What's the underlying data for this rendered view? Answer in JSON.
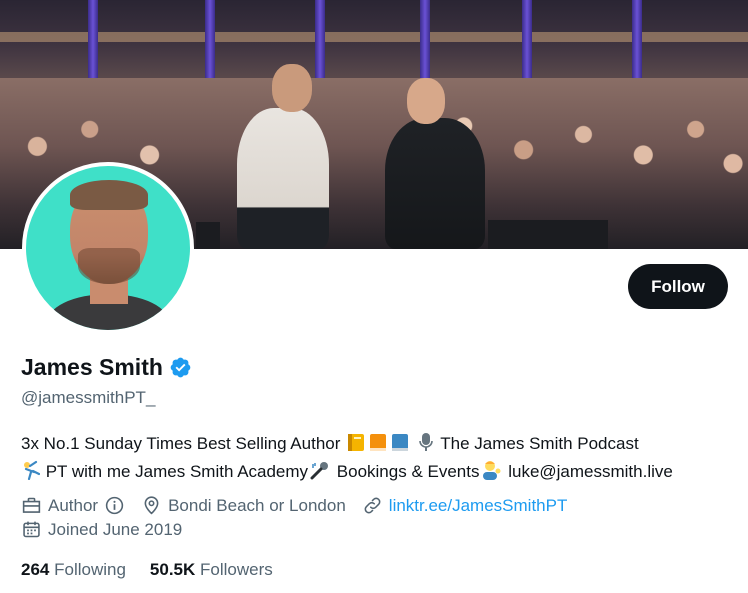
{
  "profile": {
    "display_name": "James Smith",
    "handle": "@jamessmithPT_",
    "verified": true,
    "follow_label": "Follow"
  },
  "bio": {
    "line1_text1": "3x No.1 Sunday Times Best Selling Author ",
    "line1_text2": " The James Smith Podcast",
    "line2_text1": " PT with me James Smith Academy",
    "line2_text2": " Bookings & Events",
    "line2_text3": " luke@jamessmith.live"
  },
  "meta": {
    "category": "Author",
    "location": "Bondi Beach or London",
    "website": "linktr.ee/JamesSmithPT",
    "joined": "Joined June 2019"
  },
  "stats": {
    "following_count": "264",
    "following_label": "Following",
    "followers_count": "50.5K",
    "followers_label": "Followers"
  },
  "colors": {
    "accent": "#1d9bf0",
    "text_primary": "#0f1419",
    "text_secondary": "#536471",
    "follow_button_bg": "#0f1419",
    "avatar_bg": "#3fe0c8"
  },
  "icons": [
    "verified-badge-icon",
    "briefcase-icon",
    "info-icon",
    "location-pin-icon",
    "link-icon",
    "calendar-icon"
  ]
}
